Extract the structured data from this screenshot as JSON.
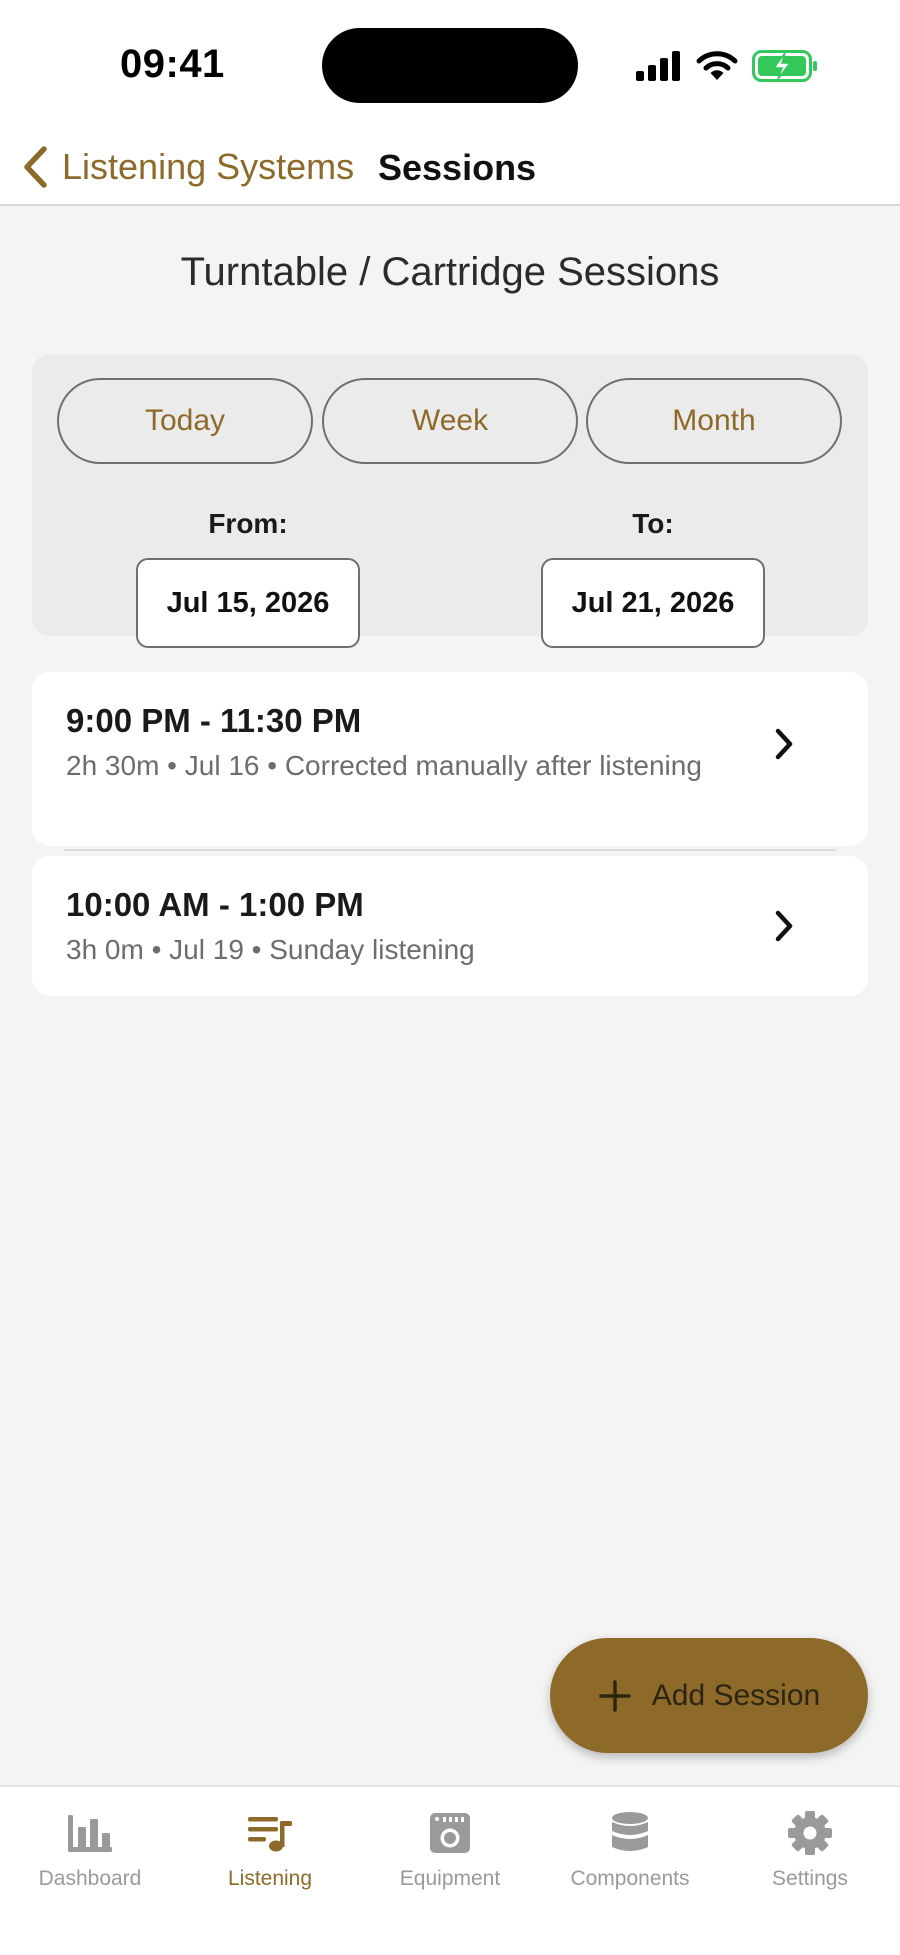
{
  "status_bar": {
    "time": "09:41"
  },
  "nav": {
    "back_label": "Listening Systems",
    "title": "Sessions"
  },
  "page": {
    "title": "Turntable / Cartridge Sessions"
  },
  "filters": {
    "ranges": [
      "Today",
      "Week",
      "Month"
    ],
    "from_label": "From:",
    "from_value": "Jul 15, 2026",
    "to_label": "To:",
    "to_value": "Jul 21, 2026"
  },
  "sessions": [
    {
      "time": "9:00 PM - 11:30 PM",
      "meta": "2h 30m • Jul 16 • Corrected manually after listening"
    },
    {
      "time": "10:00 AM - 1:00 PM",
      "meta": "3h 0m • Jul 19 • Sunday listening"
    }
  ],
  "fab": {
    "label": "Add Session"
  },
  "tabs": [
    {
      "label": "Dashboard",
      "icon": "bar-chart-icon"
    },
    {
      "label": "Listening",
      "icon": "music-list-icon"
    },
    {
      "label": "Equipment",
      "icon": "amplifier-icon"
    },
    {
      "label": "Components",
      "icon": "database-icon"
    },
    {
      "label": "Settings",
      "icon": "gear-icon"
    }
  ],
  "colors": {
    "accent": "#8e6a2a",
    "background": "#f4f4f4",
    "battery": "#34c759",
    "inactive": "#9a9a9a"
  }
}
